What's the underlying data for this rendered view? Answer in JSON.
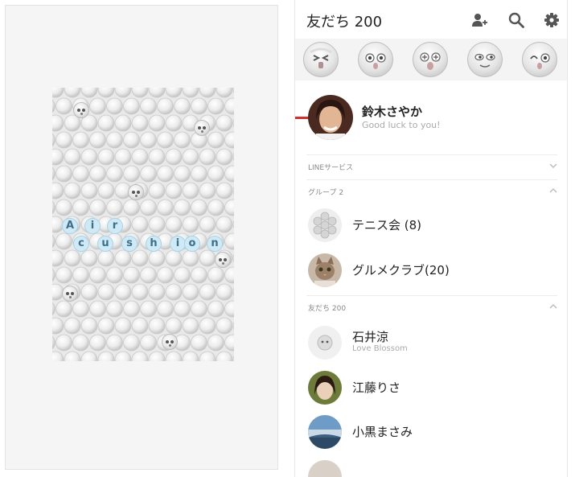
{
  "preview": {
    "air_letters": [
      "A",
      "i",
      "r"
    ],
    "cushion_letters": [
      "c",
      "u",
      "s",
      "h",
      "i",
      "o",
      "n"
    ]
  },
  "header": {
    "title": "友だち 200",
    "icons": [
      "add-friend-icon",
      "search-icon",
      "gear-icon"
    ]
  },
  "sticker_tabs": [
    "sticker-squint",
    "sticker-wide-eyes",
    "sticker-dizzy",
    "sticker-smirk",
    "sticker-wink"
  ],
  "accent_color": "#d32f2f",
  "profile": {
    "name": "鈴木さやか",
    "status": "Good luck to you!"
  },
  "sections": {
    "line_services": "LINEサービス",
    "groups": "グループ 2",
    "friends": "友だち 200"
  },
  "groups": [
    {
      "name": "テニス会 (8)"
    },
    {
      "name": "グルメクラブ(20)"
    }
  ],
  "friends": [
    {
      "name": "石井涼",
      "status": "Love Blossom"
    },
    {
      "name": "江藤りさ",
      "status": ""
    },
    {
      "name": "小黒まさみ",
      "status": ""
    }
  ]
}
